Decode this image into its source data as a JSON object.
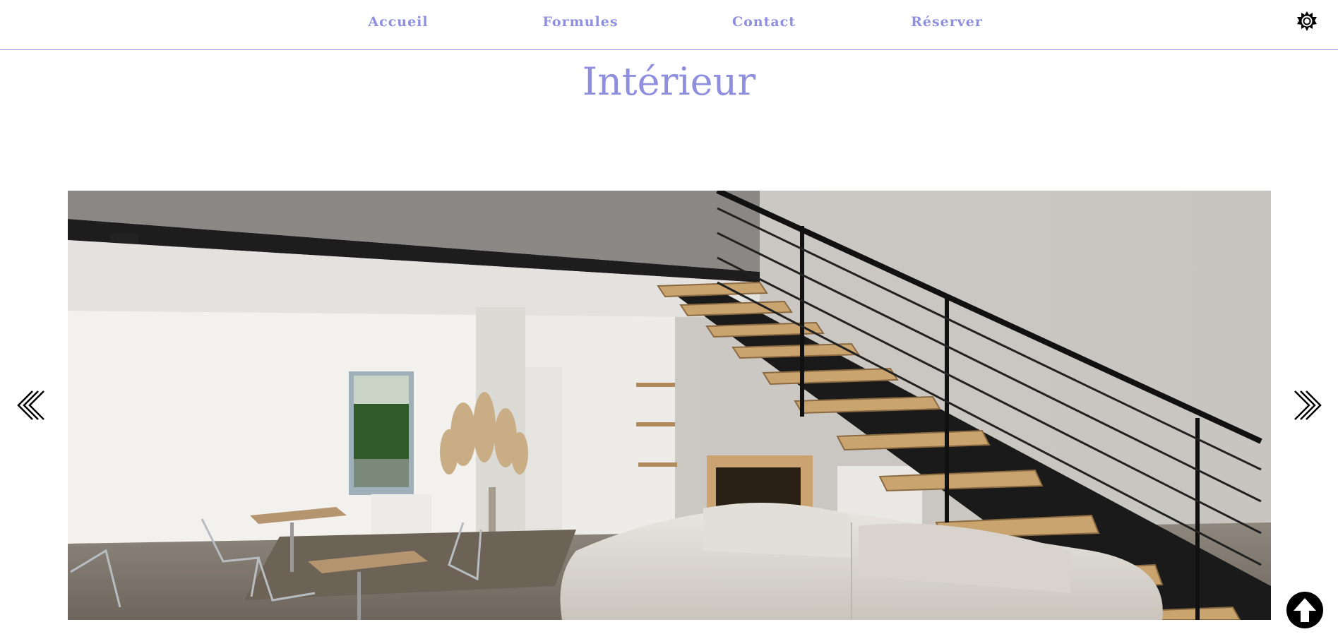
{
  "nav": {
    "items": [
      {
        "label": "Accueil"
      },
      {
        "label": "Formules"
      },
      {
        "label": "Contact"
      },
      {
        "label": "Réserver"
      }
    ],
    "theme_toggle_icon": "sun-icon",
    "link_color": "#8f8fe0"
  },
  "page": {
    "title": "Intérieur",
    "accent_color": "#8f8fe0"
  },
  "carousel": {
    "prev_icon": "double-chevron-left-icon",
    "next_icon": "double-chevron-right-icon",
    "current_image": "interior-photo"
  },
  "scroll_top": {
    "icon": "arrow-up-icon"
  }
}
